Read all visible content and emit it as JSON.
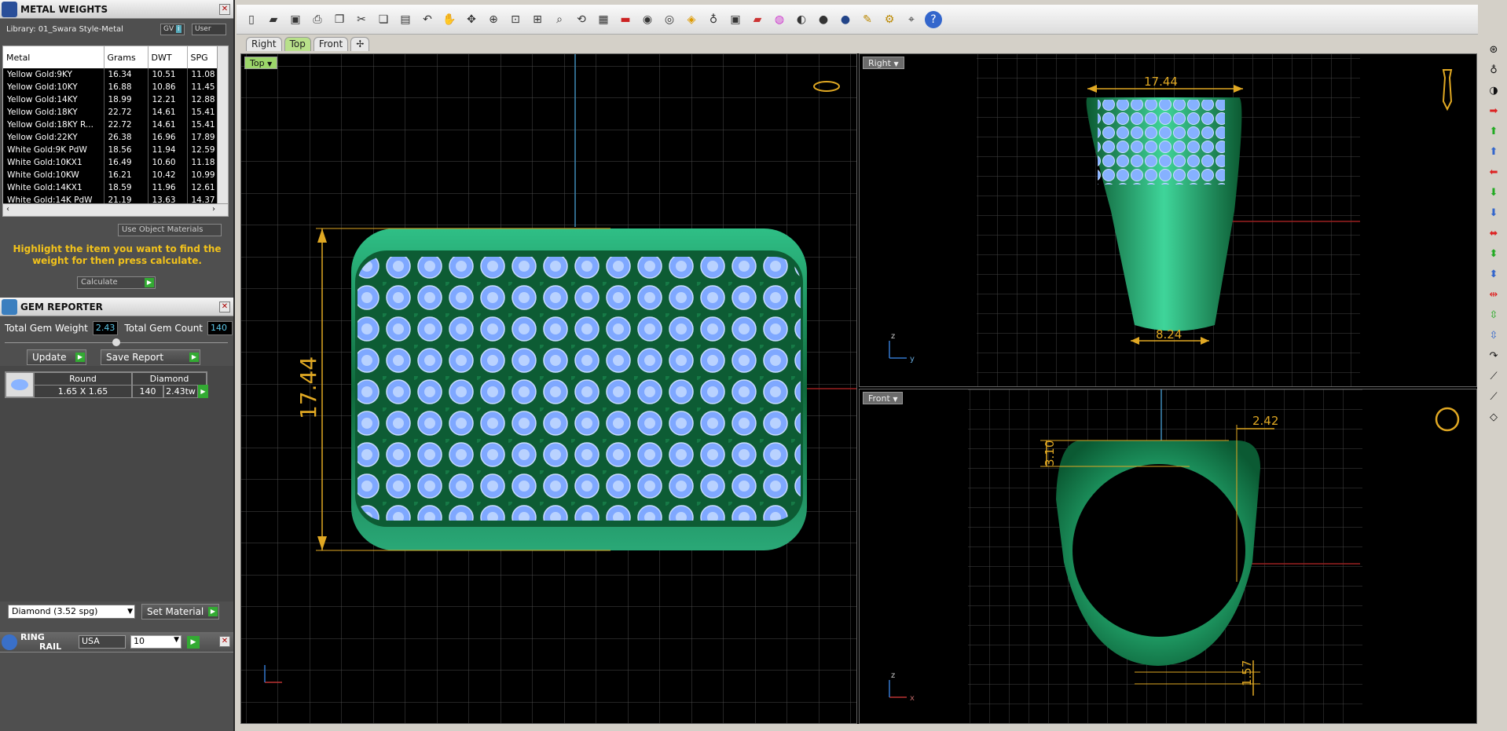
{
  "metal_panel": {
    "title": "METAL WEIGHTS",
    "library": "Library: 01_Swara Style-Metal",
    "gv_label": "GV",
    "user_label": "User",
    "columns": [
      "Metal",
      "Grams",
      "DWT",
      "SPG"
    ],
    "rows": [
      [
        "Yellow Gold:9KY",
        "16.34",
        "10.51",
        "11.08"
      ],
      [
        "Yellow Gold:10KY",
        "16.88",
        "10.86",
        "11.45"
      ],
      [
        "Yellow Gold:14KY",
        "18.99",
        "12.21",
        "12.88"
      ],
      [
        "Yellow Gold:18KY",
        "22.72",
        "14.61",
        "15.41"
      ],
      [
        "Yellow Gold:18KY R...",
        "22.72",
        "14.61",
        "15.41"
      ],
      [
        "Yellow Gold:22KY",
        "26.38",
        "16.96",
        "17.89"
      ],
      [
        "White Gold:9K PdW",
        "18.56",
        "11.94",
        "12.59"
      ],
      [
        "White Gold:10KX1",
        "16.49",
        "10.60",
        "11.18"
      ],
      [
        "White Gold:10KW",
        "16.21",
        "10.42",
        "10.99"
      ],
      [
        "White Gold:14KX1",
        "18.59",
        "11.96",
        "12.61"
      ],
      [
        "White Gold:14K PdW",
        "21.19",
        "13.63",
        "14.37"
      ]
    ],
    "use_object_materials": "Use Object Materials",
    "hint": "Highlight the item you want to find the weight for then press calculate.",
    "calculate": "Calculate"
  },
  "gem_panel": {
    "title": "GEM REPORTER",
    "total_weight_label": "Total Gem Weight",
    "total_weight": "2.43",
    "total_count_label": "Total Gem Count",
    "total_count": "140",
    "update": "Update",
    "save_report": "Save Report",
    "grid_headers": [
      "Round",
      "Diamond"
    ],
    "grid_row": {
      "size": "1.65 X 1.65",
      "count": "140",
      "weight": "2.43tw"
    },
    "material_select": "Diamond    (3.52 spg)",
    "set_material": "Set Material"
  },
  "ring_rail": {
    "title_1": "RING",
    "title_2": "RAIL",
    "standard": "USA",
    "size": "10"
  },
  "view_tabs": [
    "Right",
    "Top",
    "Front"
  ],
  "active_view_tab": "Top",
  "viewports": {
    "top": {
      "label": "Top",
      "dimension": "17.44"
    },
    "right": {
      "label": "Right",
      "width_top": "17.44",
      "width_bottom": "8.24"
    },
    "front": {
      "label": "Front",
      "dim_a": "3.10",
      "dim_b": "2.42",
      "dim_c": "1.57"
    }
  },
  "colors": {
    "accent_dim": "#e0a823",
    "ring_green": "#1f7a4c",
    "gem_blue": "#7fb0ff"
  }
}
